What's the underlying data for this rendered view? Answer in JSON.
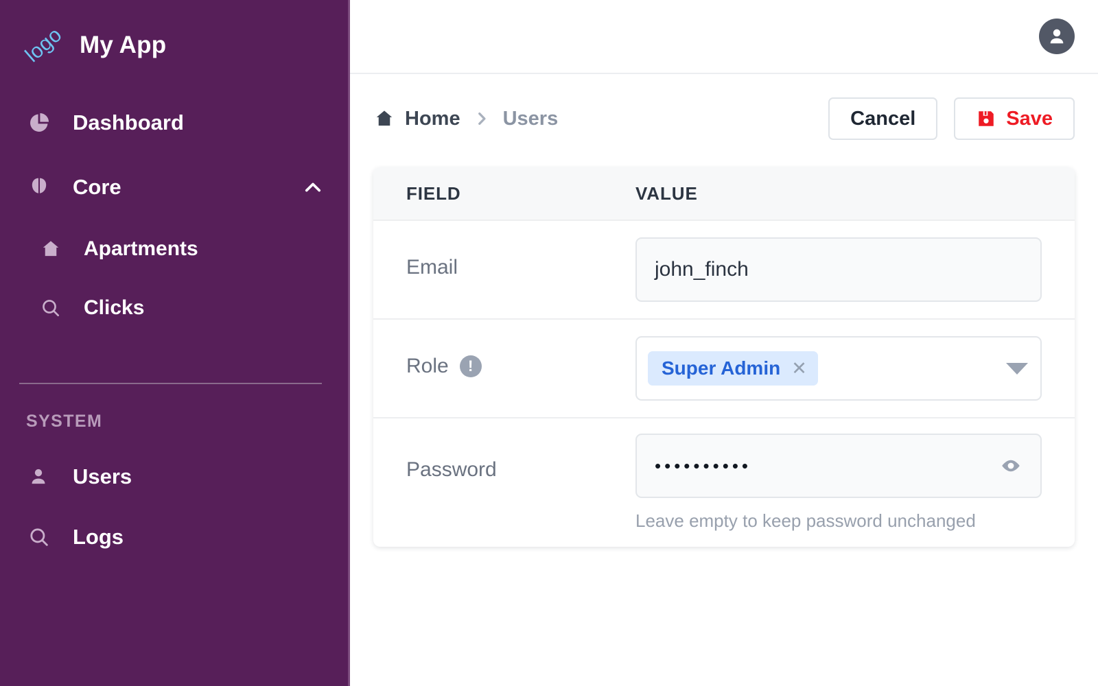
{
  "colors": {
    "sidebar_bg": "#571f59",
    "accent_blue": "#2563d6",
    "chip_bg": "#dbeafe",
    "save_red": "#ee1b24",
    "logo_blue": "#6ec4f2"
  },
  "sidebar": {
    "logo_text": "logo",
    "app_title": "My App",
    "items": [
      {
        "label": "Dashboard",
        "icon": "pie-chart-icon"
      },
      {
        "label": "Core",
        "icon": "brain-icon",
        "expanded": true,
        "chevron": "chevron-up-icon"
      }
    ],
    "core_children": [
      {
        "label": "Apartments",
        "icon": "home-icon"
      },
      {
        "label": "Clicks",
        "icon": "search-icon"
      }
    ],
    "section_label": "SYSTEM",
    "system_items": [
      {
        "label": "Users",
        "icon": "person-icon"
      },
      {
        "label": "Logs",
        "icon": "search-icon"
      }
    ]
  },
  "topbar": {
    "avatar_icon": "user-avatar-icon"
  },
  "breadcrumb": {
    "home_icon": "home-icon",
    "separator": "chevron-right-icon",
    "items": [
      {
        "label": "Home",
        "active": true
      },
      {
        "label": "Users",
        "active": false
      }
    ]
  },
  "actions": {
    "cancel_label": "Cancel",
    "save_label": "Save",
    "save_icon": "floppy-disk-save-icon"
  },
  "form_table": {
    "columns": {
      "field": "FIELD",
      "value": "VALUE"
    },
    "rows": [
      {
        "label": "Email",
        "control": "text-input",
        "value": "john_finch",
        "placeholder": ""
      },
      {
        "label": "Role",
        "info_icon": "info-exclamation-icon",
        "control": "multi-select",
        "chips": [
          {
            "label": "Super Admin",
            "remove_icon": "close-x-icon"
          }
        ],
        "caret_icon": "caret-down-icon"
      },
      {
        "label": "Password",
        "control": "password-input",
        "value": "••••••••••",
        "toggle_icon": "eye-visibility-icon",
        "helper_text": "Leave empty to keep password unchanged"
      }
    ]
  }
}
